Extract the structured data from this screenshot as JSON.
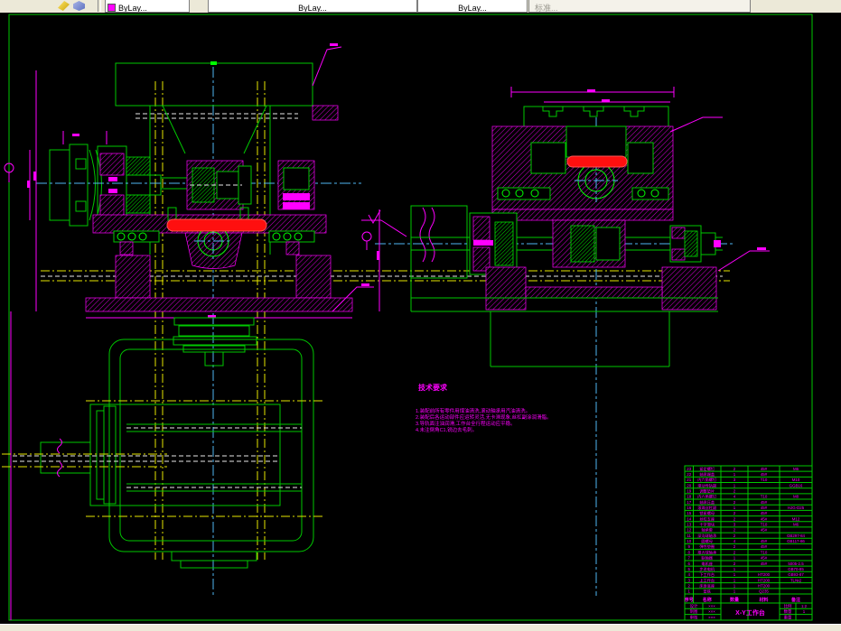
{
  "toolbar": {
    "combo1": "ByLay...",
    "combo2": "ByLay...",
    "combo3": "ByLay...",
    "combo4": "标准..."
  },
  "tech": {
    "heading": "技术要求",
    "lines": [
      "1.装配前所有零件用煤油清洗,滚动轴承用汽油清洗。",
      "2.装配后各运动部件应运转灵活,无卡滞现象,丝杠副涂润滑脂。",
      "3.导轨面注油润滑,工作台全行程运动应平稳。",
      "4.未注倒角C1,锐边去毛刺。"
    ]
  },
  "title_block": {
    "headers": [
      "序号",
      "名称",
      "数量",
      "材料",
      "备注"
    ],
    "parts": [
      [
        "23",
        "紧定螺钉",
        "2",
        "45#",
        "M6"
      ],
      [
        "22",
        "轴承端盖",
        "1",
        "45#",
        ""
      ],
      [
        "21",
        "内六角螺钉",
        "3",
        "T10",
        "M10"
      ],
      [
        "20",
        "滚动导轨副",
        "1",
        "",
        "GGB16"
      ],
      [
        "19",
        "调整垫片",
        "2",
        "",
        ""
      ],
      [
        "18",
        "内六角螺钉",
        "4",
        "T10",
        "M8"
      ],
      [
        "17",
        "轴承压盖",
        "2",
        "45#",
        ""
      ],
      [
        "16",
        "滚珠丝杠副",
        "1",
        "45#",
        "HJG-D25"
      ],
      [
        "15",
        "锁紧螺母",
        "2",
        "45#",
        ""
      ],
      [
        "14",
        "丝杠支座",
        "2",
        "45#",
        "M12"
      ],
      [
        "13",
        "十字滑块",
        "3",
        "T10",
        "M6"
      ],
      [
        "12",
        "轴承套",
        "2",
        "45#",
        ""
      ],
      [
        "11",
        "深沟球轴承",
        "2",
        "",
        "GB297-84"
      ],
      [
        "10",
        "圆螺母",
        "4",
        "45#",
        "GB117-86"
      ],
      [
        "9",
        "弹性垫圈",
        "2",
        "45#",
        ""
      ],
      [
        "8",
        "推力球轴承",
        "2",
        "T10",
        ""
      ],
      [
        "7",
        "联轴器",
        "1",
        "45#",
        ""
      ],
      [
        "6",
        "电机座",
        "2",
        "45#",
        "5005-2.5"
      ],
      [
        "5",
        "步进电机",
        "1",
        "",
        "GB70-85"
      ],
      [
        "4",
        "下工作台",
        "1",
        "HT200",
        "GB93-87"
      ],
      [
        "3",
        "上工作台",
        "1",
        "HT200",
        "TL№2"
      ],
      [
        "2",
        "床身底座",
        "1",
        "HT200",
        ""
      ],
      [
        "1",
        "垫铁",
        "1",
        "Q235",
        ""
      ]
    ],
    "left_rows": [
      [
        "设计",
        "×××"
      ],
      [
        "制图",
        "×××"
      ],
      [
        "审核",
        "×××"
      ]
    ],
    "right_rows": [
      [
        "比例",
        "1:2"
      ],
      [
        "数量",
        "1"
      ],
      [
        "重量",
        ""
      ]
    ],
    "title": "X-Y工作台"
  },
  "colors": {
    "outline_green": "#00c800",
    "hatch_magenta": "#ff00ff",
    "centerline_cyan": "#4fb6f2",
    "hidden_yellow": "#e6e600",
    "selected_red": "#ff0f0f"
  }
}
